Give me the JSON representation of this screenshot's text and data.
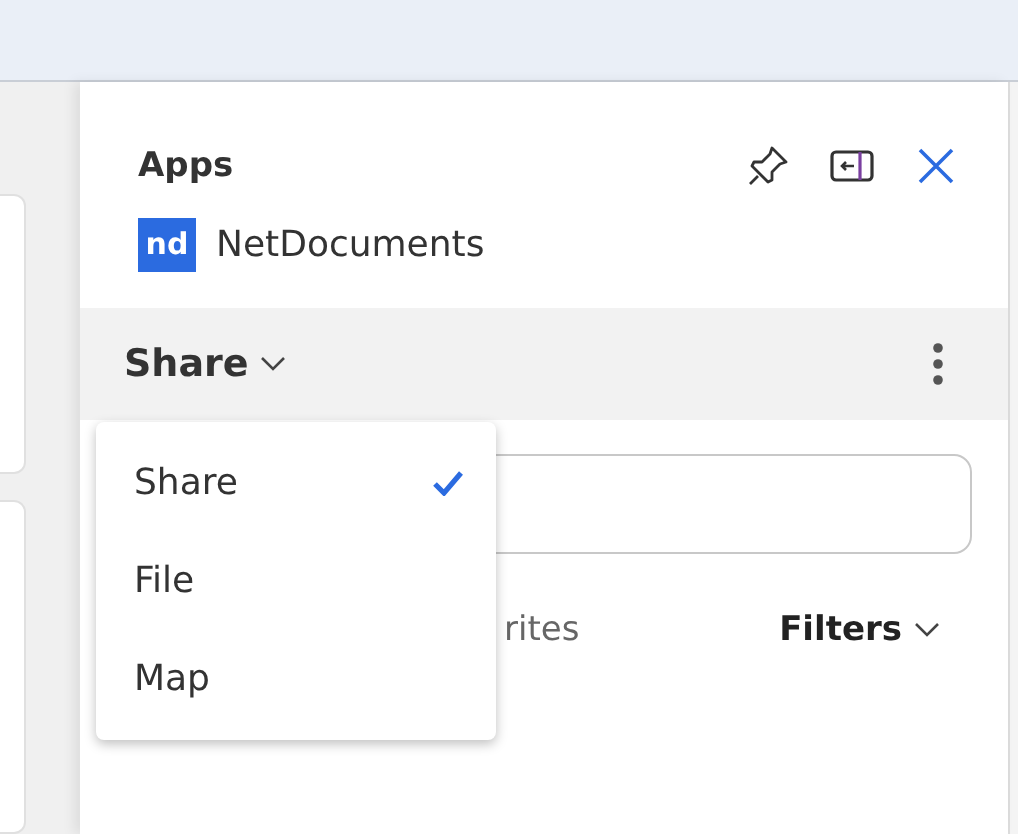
{
  "panel": {
    "title": "Apps",
    "app": {
      "logo": "nd",
      "name": "NetDocuments"
    },
    "mode": {
      "label": "Share"
    },
    "menu": [
      {
        "label": "Share",
        "selected": true
      },
      {
        "label": "File",
        "selected": false
      },
      {
        "label": "Map",
        "selected": false
      }
    ],
    "tab_partial": "rites",
    "filters": "Filters"
  }
}
